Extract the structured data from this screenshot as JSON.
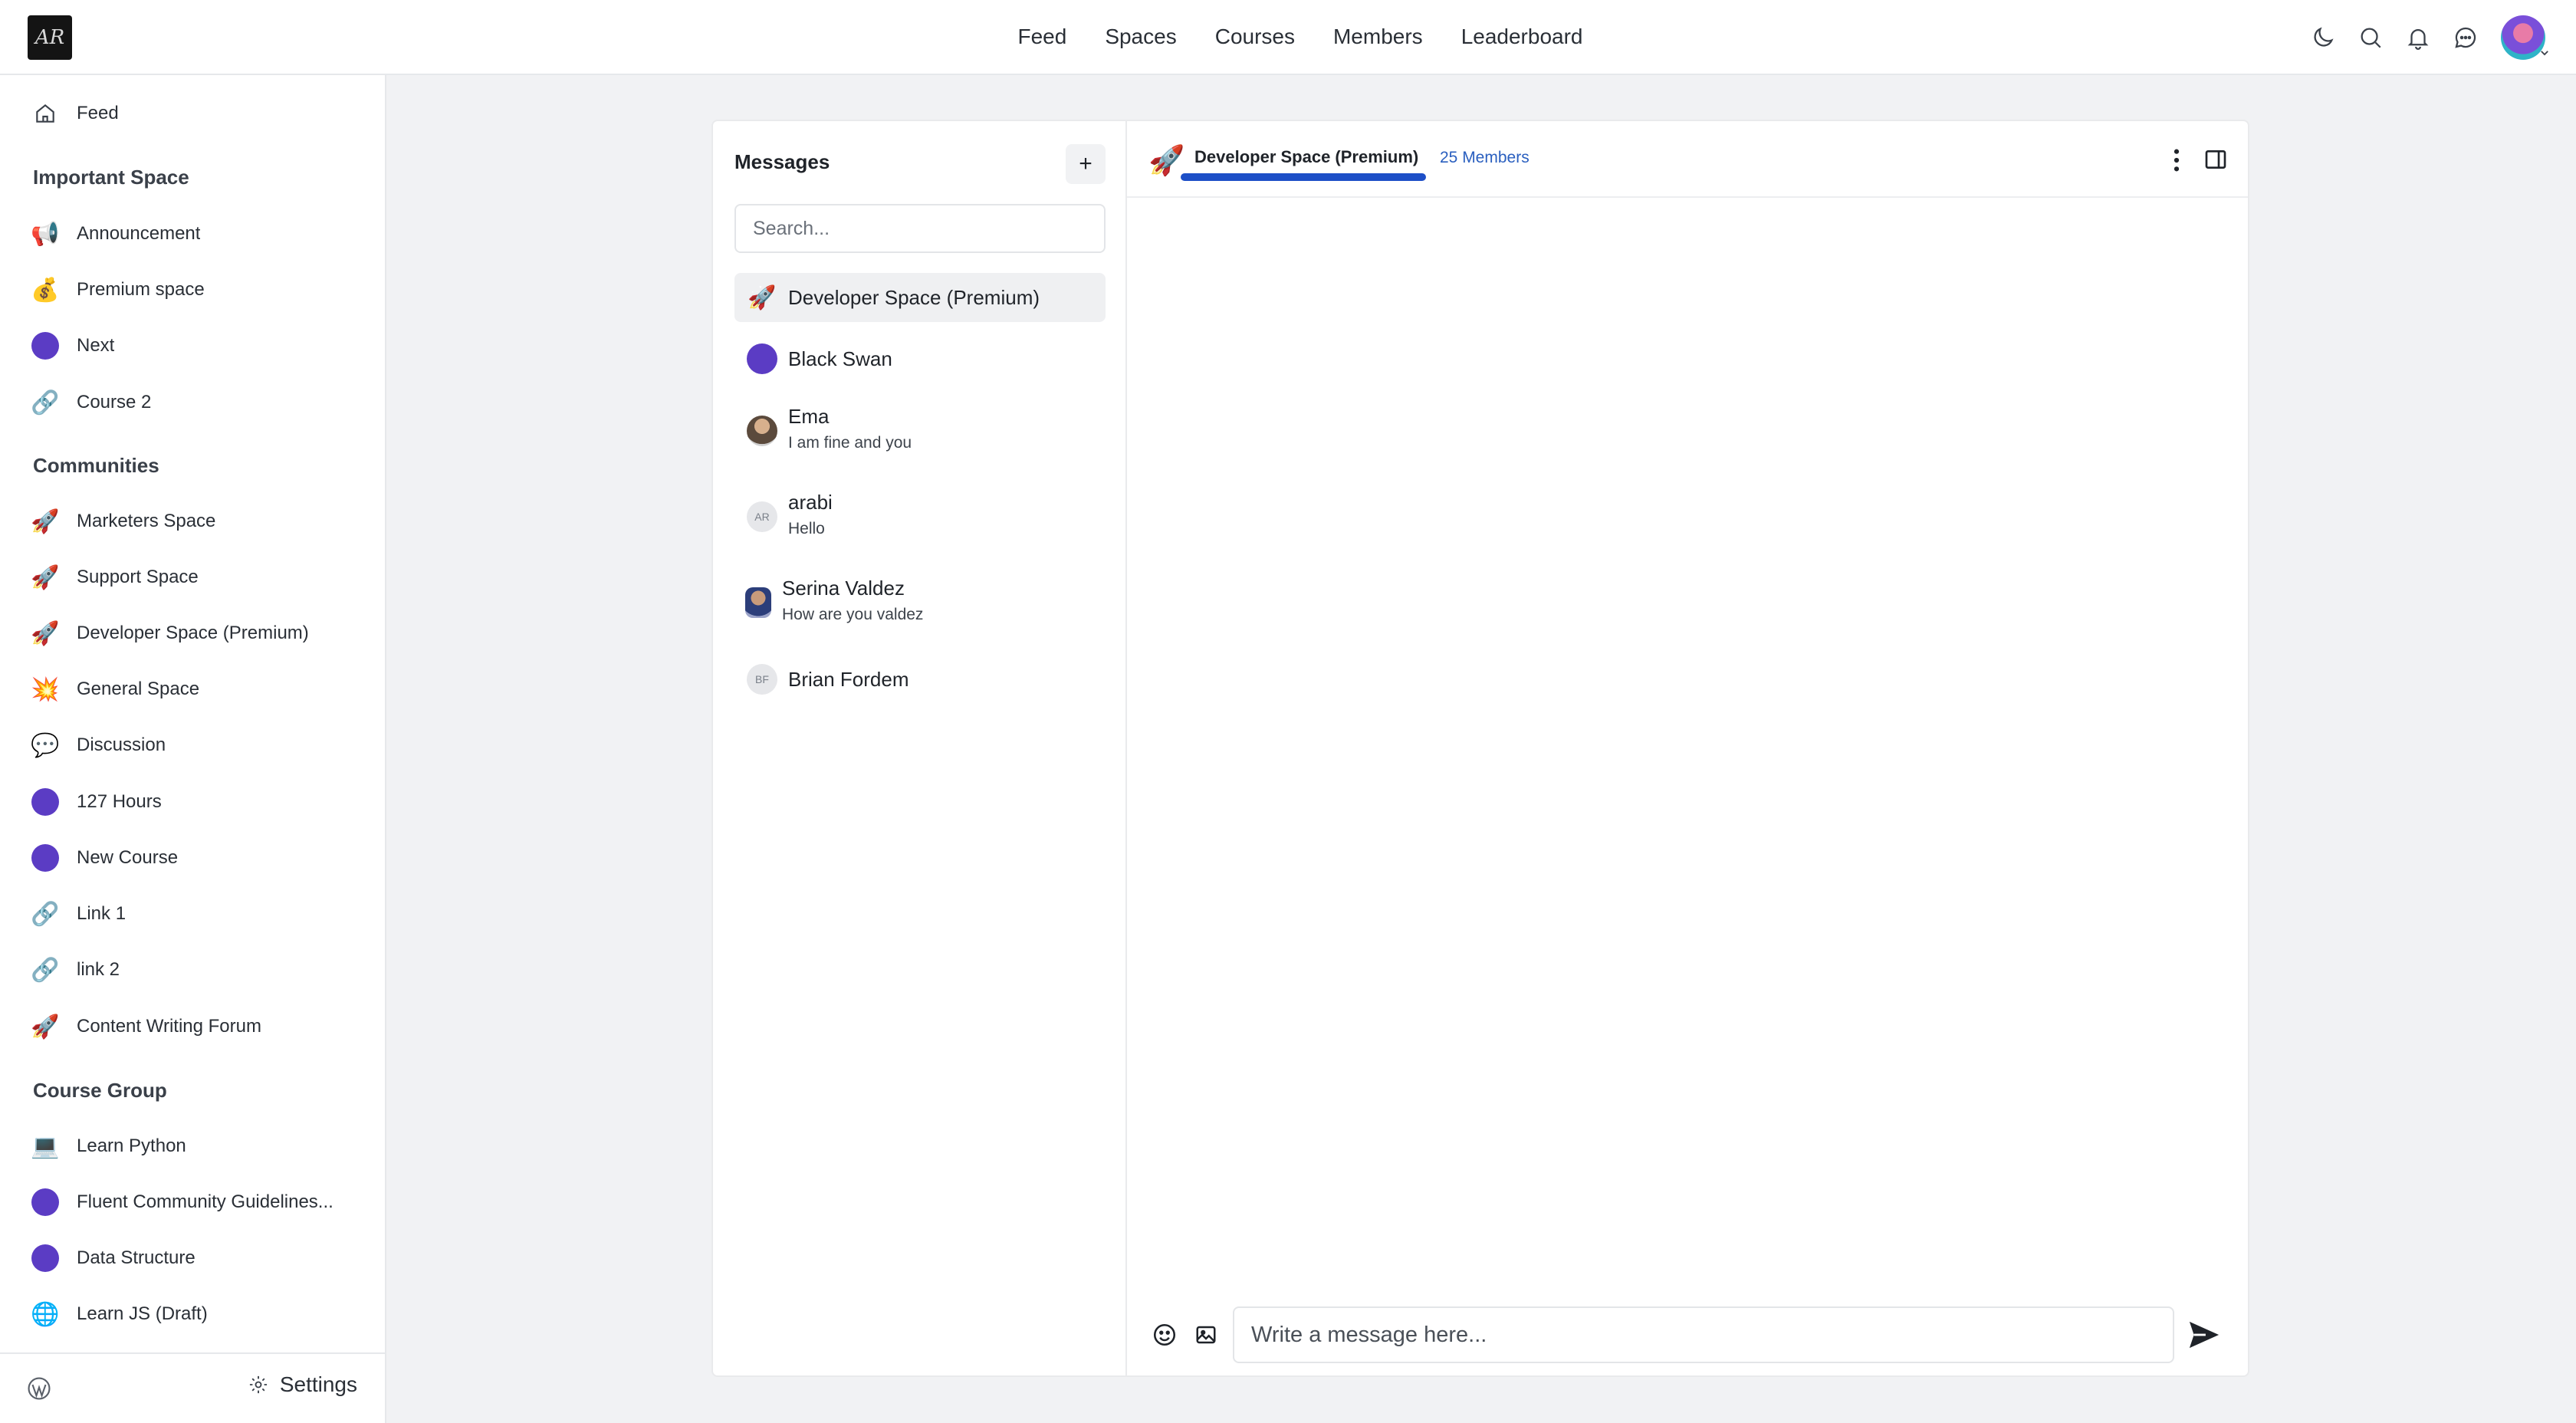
{
  "topnav": {
    "items": [
      "Feed",
      "Spaces",
      "Courses",
      "Members",
      "Leaderboard"
    ]
  },
  "topicons": [
    "moon-icon",
    "search-icon",
    "bell-icon",
    "chat-icon",
    "user-avatar"
  ],
  "sidebar": {
    "feed_label": "Feed",
    "heading_important": "Important Space",
    "important": [
      {
        "label": "Announcement",
        "icon": "megaphone-icon"
      },
      {
        "label": "Premium space",
        "icon": "money-bag-icon"
      },
      {
        "label": "Next",
        "icon": "purple-dot-icon"
      },
      {
        "label": "Course 2",
        "icon": "link-icon"
      }
    ],
    "heading_communities": "Communities",
    "communities": [
      {
        "label": "Marketers Space",
        "icon": "rocket-icon"
      },
      {
        "label": "Support Space",
        "icon": "rocket-icon"
      },
      {
        "label": "Developer Space (Premium)",
        "icon": "rocket-icon"
      },
      {
        "label": "General Space",
        "icon": "explosion-icon"
      },
      {
        "label": "Discussion",
        "icon": "speech-bubble-icon"
      },
      {
        "label": "127 Hours",
        "icon": "purple-dot-icon"
      },
      {
        "label": "New Course",
        "icon": "purple-dot-icon"
      },
      {
        "label": "Link 1",
        "icon": "link-icon"
      },
      {
        "label": "link 2",
        "icon": "link-icon"
      },
      {
        "label": "Content Writing Forum",
        "icon": "rocket-icon"
      }
    ],
    "heading_course": "Course Group",
    "courses": [
      {
        "label": "Learn Python",
        "icon": "laptop-icon"
      },
      {
        "label": "Fluent Community Guidelines...",
        "icon": "purple-dot-icon"
      },
      {
        "label": "Data Structure",
        "icon": "purple-dot-icon"
      },
      {
        "label": "Learn JS (Draft)",
        "icon": "globe-icon"
      }
    ],
    "settings_label": "Settings"
  },
  "messages": {
    "title": "Messages",
    "add_label": "+",
    "search_placeholder": "Search...",
    "conversations": [
      {
        "name": "Developer Space (Premium)",
        "sub": "",
        "avatar": "rocket-icon",
        "active": true
      },
      {
        "name": "Black Swan",
        "sub": "",
        "avatar": "purple-dot-icon"
      },
      {
        "name": "Ema",
        "sub": "I am fine and you",
        "avatar": "photo"
      },
      {
        "name": "arabi",
        "sub": "Hello",
        "avatar": "AR"
      },
      {
        "name": "Serina Valdez",
        "sub": "How are you valdez",
        "avatar": "photo"
      },
      {
        "name": "Brian Fordem",
        "sub": "",
        "avatar": "BF"
      }
    ]
  },
  "chat": {
    "title": "Developer Space (Premium)",
    "members": "25 Members",
    "input_placeholder": "Write a message here..."
  },
  "colors": {
    "accent": "#1d4fc7",
    "purple": "#5b3cc4",
    "link": "#2a5fbf"
  }
}
